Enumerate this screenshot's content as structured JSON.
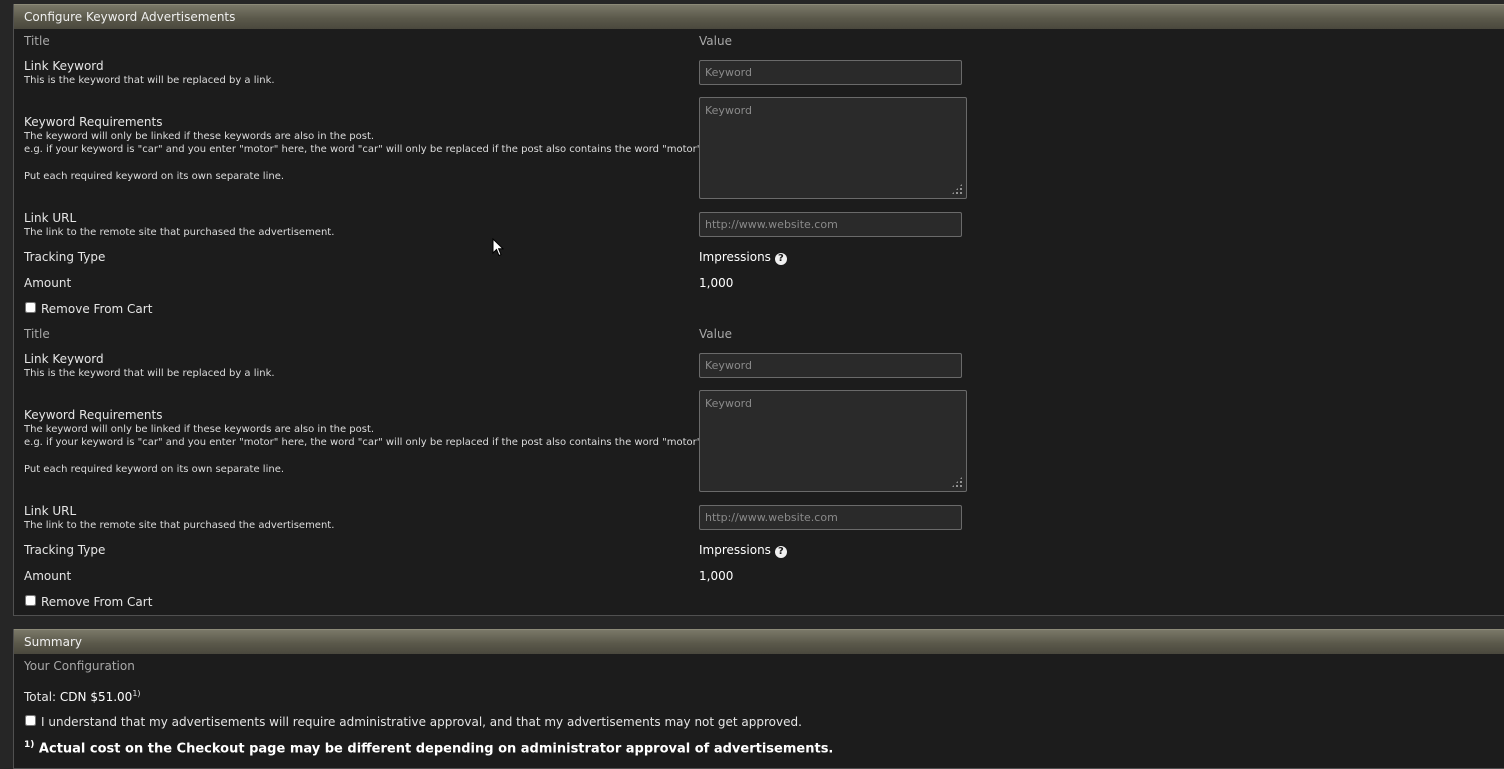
{
  "configure": {
    "title": "Configure Keyword Advertisements",
    "ads": [
      {
        "title_header": "Title",
        "value_header": "Value",
        "link_keyword": {
          "label": "Link Keyword",
          "desc": "This is the keyword that will be replaced by a link.",
          "placeholder": "Keyword"
        },
        "keyword_requirements": {
          "label": "Keyword Requirements",
          "desc1": "The keyword will only be linked if these keywords are also in the post.",
          "desc2": "e.g. if your keyword is \"car\" and you enter \"motor\" here, the word \"car\" will only be replaced if the post also contains the word \"motor\".",
          "desc3": "Put each required keyword on its own separate line.",
          "placeholder": "Keyword"
        },
        "link_url": {
          "label": "Link URL",
          "desc": "The link to the remote site that purchased the advertisement.",
          "placeholder": "http://www.website.com"
        },
        "tracking_type": {
          "label": "Tracking Type",
          "value": "Impressions",
          "help_icon": "question-circle-icon"
        },
        "amount": {
          "label": "Amount",
          "value": "1,000"
        },
        "remove": {
          "label": "Remove From Cart"
        }
      },
      {
        "title_header": "Title",
        "value_header": "Value",
        "link_keyword": {
          "label": "Link Keyword",
          "desc": "This is the keyword that will be replaced by a link.",
          "placeholder": "Keyword"
        },
        "keyword_requirements": {
          "label": "Keyword Requirements",
          "desc1": "The keyword will only be linked if these keywords are also in the post.",
          "desc2": "e.g. if your keyword is \"car\" and you enter \"motor\" here, the word \"car\" will only be replaced if the post also contains the word \"motor\".",
          "desc3": "Put each required keyword on its own separate line.",
          "placeholder": "Keyword"
        },
        "link_url": {
          "label": "Link URL",
          "desc": "The link to the remote site that purchased the advertisement.",
          "placeholder": "http://www.website.com"
        },
        "tracking_type": {
          "label": "Tracking Type",
          "value": "Impressions",
          "help_icon": "question-circle-icon"
        },
        "amount": {
          "label": "Amount",
          "value": "1,000"
        },
        "remove": {
          "label": "Remove From Cart"
        }
      }
    ]
  },
  "summary": {
    "title": "Summary",
    "subtitle": "Your Configuration",
    "total_label": "Total:",
    "total_value": "CDN $51.00",
    "footnote_marker": "1)",
    "approval_label": "I understand that my advertisements will require administrative approval, and that my advertisements may not get approved.",
    "footnote_text": "Actual cost on the Checkout page may be different depending on administrator approval of advertisements."
  }
}
